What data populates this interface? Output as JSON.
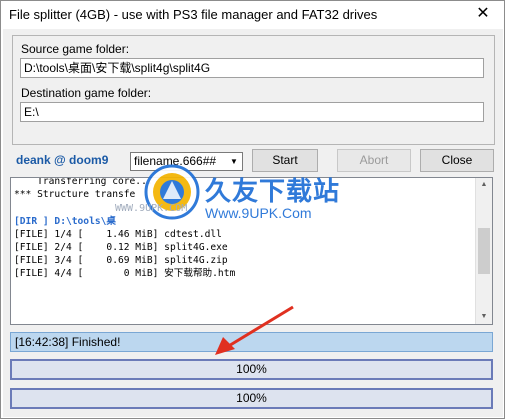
{
  "window": {
    "title": "File splitter (4GB) - use with PS3 file manager and FAT32 drives",
    "close_glyph": "✕"
  },
  "source": {
    "label": "Source game folder:",
    "value": "D:\\tools\\桌面\\安下载\\split4g\\split4G"
  },
  "destination": {
    "label": "Destination game folder:",
    "value": "E:\\"
  },
  "credit": "deank @ doom9",
  "filename_mode": {
    "selected": "filename.666##"
  },
  "buttons": {
    "start": "Start",
    "abort": "Abort",
    "close": "Close"
  },
  "log": {
    "lines": [
      "    Transferring core...",
      "*** Structure transfe",
      "",
      "[DIR ] D:\\tools\\桌",
      "[FILE] 1/4 [    1.46 MiB] cdtest.dll",
      "[FILE] 2/4 [    0.12 MiB] split4G.exe",
      "[FILE] 3/4 [    0.69 MiB] split4G.zip",
      "[FILE] 4/4 [       0 MiB] 安下载帮助.htm"
    ]
  },
  "status": {
    "text": "[16:42:38] Finished!"
  },
  "progress": [
    {
      "label": "100%",
      "value": 1.0
    },
    {
      "label": "100%",
      "value": 1.0
    }
  ],
  "watermark": {
    "brand": "久友下载站",
    "url": "Www.9UPK.Com",
    "url_small": "WWW.9UPK.COM"
  },
  "colors": {
    "status_bg": "#bcd7ef",
    "progress_border": "#6b7bb8",
    "credit": "#1b5aa6",
    "arrow": "#e03020",
    "watermark": "#1f6fd6"
  }
}
